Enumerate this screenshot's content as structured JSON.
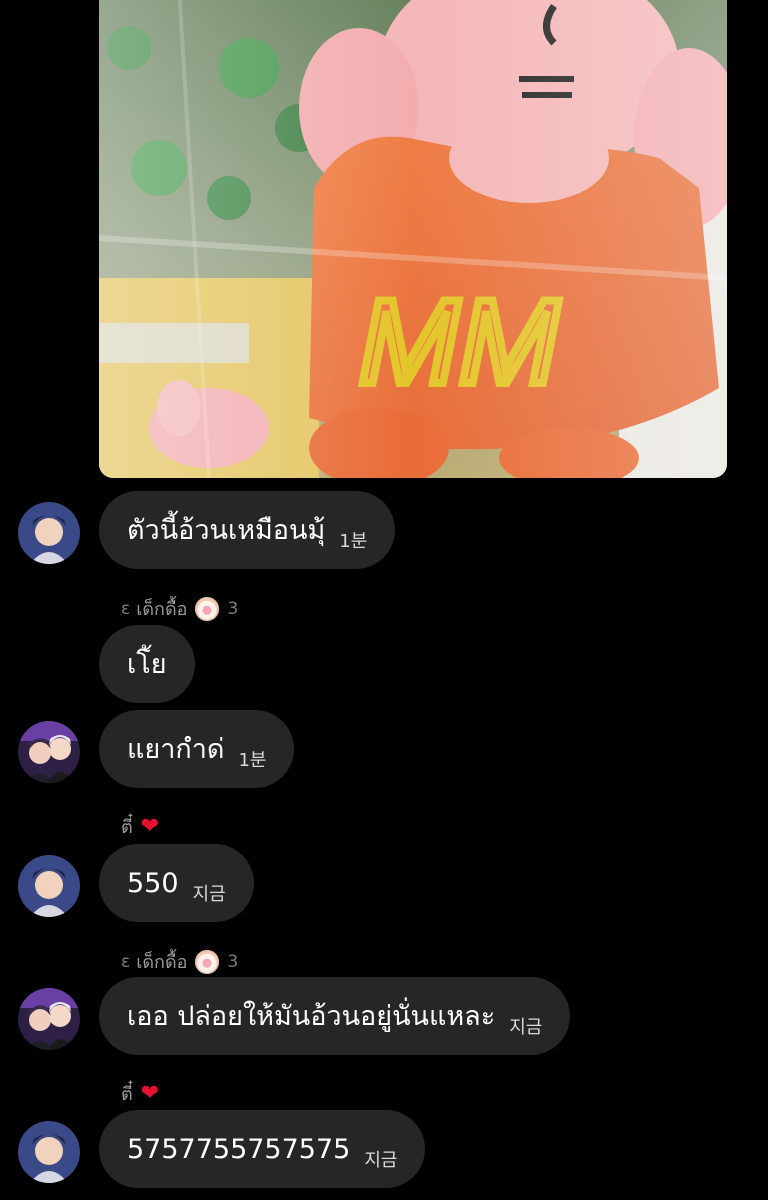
{
  "photo": {
    "embroidered_text": "MM"
  },
  "messages": [
    {
      "text": "ตัวนี้อ้วนเหมือนมุ้",
      "time": "1분"
    },
    {
      "text": "เโ้ย",
      "time": ""
    },
    {
      "text": "แยากำด่",
      "time": "1분"
    },
    {
      "text": "550",
      "time": "지금"
    },
    {
      "text": "เออ ปล่อยให้มันอ้วนอยู่นั่นแหละ",
      "time": "지금"
    },
    {
      "text": "5757755757575",
      "time": "지금"
    }
  ],
  "labels": [
    {
      "prefix": "ε",
      "name": "เด็กดื้อ",
      "suffix": "3"
    },
    {
      "name": "ตี๋"
    },
    {
      "prefix": "ε",
      "name": "เด็กดื้อ",
      "suffix": "3"
    },
    {
      "name": "ตี๋"
    }
  ],
  "colors": {
    "background": "#000000",
    "bubble": "#262626",
    "heart": "#e8112d"
  }
}
